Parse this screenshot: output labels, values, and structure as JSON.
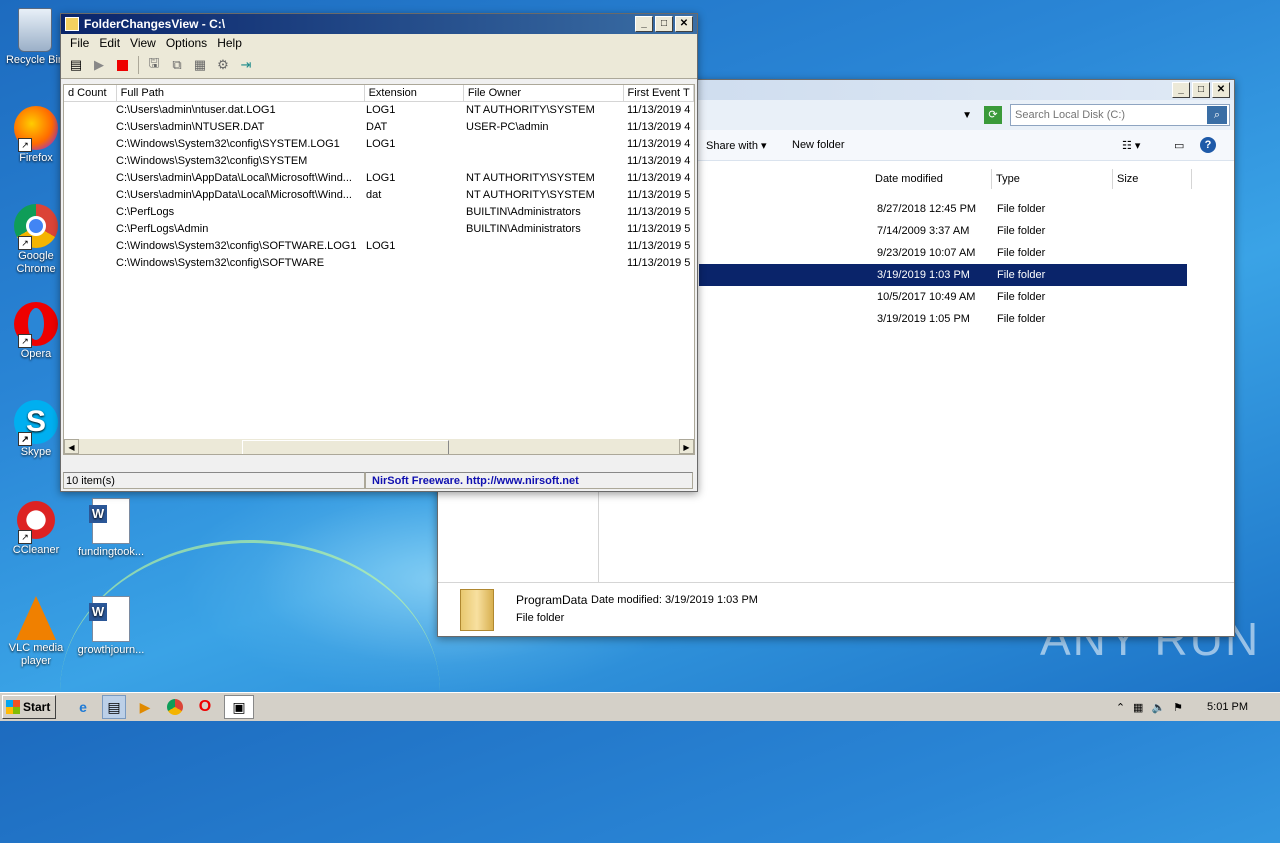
{
  "desktop": {
    "icons": [
      {
        "label": "Recycle Bin"
      },
      {
        "label": "Firefox"
      },
      {
        "label": "Google Chrome"
      },
      {
        "label": "Opera"
      },
      {
        "label": "Skype"
      },
      {
        "label": "CCleaner"
      },
      {
        "label": "fundingtook..."
      },
      {
        "label": "VLC media player"
      },
      {
        "label": "growthjourn..."
      }
    ],
    "watermark": "ANY RUN"
  },
  "fcv": {
    "title": "FolderChangesView  -  C:\\",
    "menu": [
      "File",
      "Edit",
      "View",
      "Options",
      "Help"
    ],
    "columns": [
      "d Count",
      "Full Path",
      "Extension",
      "File Owner",
      "First Event T"
    ],
    "rows": [
      {
        "path": "C:\\Users\\admin\\ntuser.dat.LOG1",
        "ext": "LOG1",
        "owner": "NT AUTHORITY\\SYSTEM",
        "first": "11/13/2019 4"
      },
      {
        "path": "C:\\Users\\admin\\NTUSER.DAT",
        "ext": "DAT",
        "owner": "USER-PC\\admin",
        "first": "11/13/2019 4"
      },
      {
        "path": "C:\\Windows\\System32\\config\\SYSTEM.LOG1",
        "ext": "LOG1",
        "owner": "",
        "first": "11/13/2019 4"
      },
      {
        "path": "C:\\Windows\\System32\\config\\SYSTEM",
        "ext": "",
        "owner": "",
        "first": "11/13/2019 4"
      },
      {
        "path": "C:\\Users\\admin\\AppData\\Local\\Microsoft\\Wind...",
        "ext": "LOG1",
        "owner": "NT AUTHORITY\\SYSTEM",
        "first": "11/13/2019 4"
      },
      {
        "path": "C:\\Users\\admin\\AppData\\Local\\Microsoft\\Wind...",
        "ext": "dat",
        "owner": "NT AUTHORITY\\SYSTEM",
        "first": "11/13/2019 5"
      },
      {
        "path": "C:\\PerfLogs",
        "ext": "",
        "owner": "BUILTIN\\Administrators",
        "first": "11/13/2019 5"
      },
      {
        "path": "C:\\PerfLogs\\Admin",
        "ext": "",
        "owner": "BUILTIN\\Administrators",
        "first": "11/13/2019 5"
      },
      {
        "path": "C:\\Windows\\System32\\config\\SOFTWARE.LOG1",
        "ext": "LOG1",
        "owner": "",
        "first": "11/13/2019 5"
      },
      {
        "path": "C:\\Windows\\System32\\config\\SOFTWARE",
        "ext": "",
        "owner": "",
        "first": "11/13/2019 5"
      }
    ],
    "status_count": "10 item(s)",
    "status_credit": "NirSoft Freeware.  http://www.nirsoft.net"
  },
  "explorer": {
    "search_placeholder": "Search Local Disk (C:)",
    "toolbar": {
      "share": "Share with",
      "new_folder": "New folder"
    },
    "columns": [
      "Date modified",
      "Type",
      "Size"
    ],
    "rows": [
      {
        "date": "8/27/2018 12:45 PM",
        "type": "File folder"
      },
      {
        "date": "7/14/2009 3:37 AM",
        "type": "File folder"
      },
      {
        "date": "9/23/2019 10:07 AM",
        "type": "File folder"
      },
      {
        "date": "3/19/2019 1:03 PM",
        "type": "File folder"
      },
      {
        "date": "10/5/2017 10:49 AM",
        "type": "File folder"
      },
      {
        "date": "3/19/2019 1:05 PM",
        "type": "File folder"
      }
    ],
    "details": {
      "name": "ProgramData",
      "date_label": "Date modified: 3/19/2019 1:03 PM",
      "type": "File folder"
    }
  },
  "taskbar": {
    "start": "Start",
    "clock": "5:01 PM"
  },
  "colors": {
    "selection": "#0a246a",
    "titlebar": "#0a246a"
  }
}
